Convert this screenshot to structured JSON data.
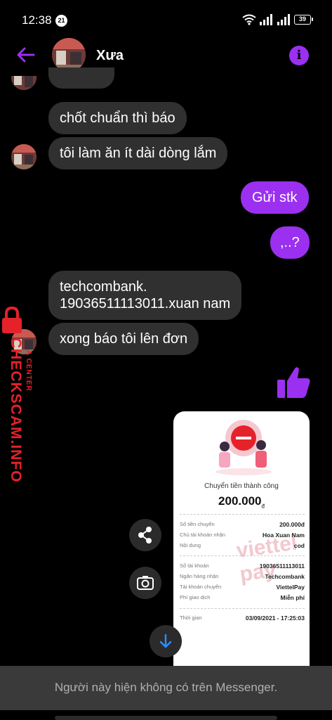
{
  "status_bar": {
    "time": "12:38",
    "notification_count": "21",
    "battery": "39"
  },
  "header": {
    "contact_name": "Xưa",
    "info_icon": "info-icon",
    "back_icon": "back-arrow-icon"
  },
  "messages": [
    {
      "side": "in",
      "text": "chốt chuẩn thì báo"
    },
    {
      "side": "in",
      "text": "tôi làm ăn ít dài dòng lắm"
    },
    {
      "side": "out",
      "text": "Gửi stk"
    },
    {
      "side": "out",
      "text": ",..?"
    },
    {
      "side": "in",
      "text": "techcombank.\n19036511113011.xuan nam"
    },
    {
      "side": "in",
      "text": "xong báo tôi lên đơn"
    }
  ],
  "reaction": "thumbs-up-icon",
  "receipt": {
    "title": "Chuyển tiền thành công",
    "amount": "200.000",
    "currency": "đ",
    "watermark": "viettel pay",
    "rows": [
      {
        "label": "Số tiền chuyển",
        "value": "200.000đ"
      },
      {
        "label": "Chủ tài khoản nhận",
        "value": "Hoa Xuan Nam"
      },
      {
        "label": "Nội dung",
        "value": "cod"
      },
      {
        "label": "Số tài khoản",
        "value": "19036511113011"
      },
      {
        "label": "Ngân hàng nhận",
        "value": "Techcombank"
      },
      {
        "label": "Tài khoản chuyển",
        "value": "ViettelPay"
      },
      {
        "label": "Phí giao dịch",
        "value": "Miễn phí"
      },
      {
        "label": "Thời gian",
        "value": "03/09/2021 - 17:25:03"
      }
    ]
  },
  "floating_buttons": {
    "share_icon": "share-icon",
    "camera_icon": "camera-icon",
    "scroll_down_icon": "arrow-down-icon"
  },
  "bottom_bar": {
    "message": "Người này hiện không có trên Messenger."
  },
  "watermark": {
    "main": "CHECKSCAM.INFO",
    "sub": "A CENTER"
  },
  "colors": {
    "accent": "#9b30f0",
    "incoming_bubble": "#303030",
    "bottom_bar": "#3a3a3a",
    "watermark_red": "#e5222a"
  }
}
